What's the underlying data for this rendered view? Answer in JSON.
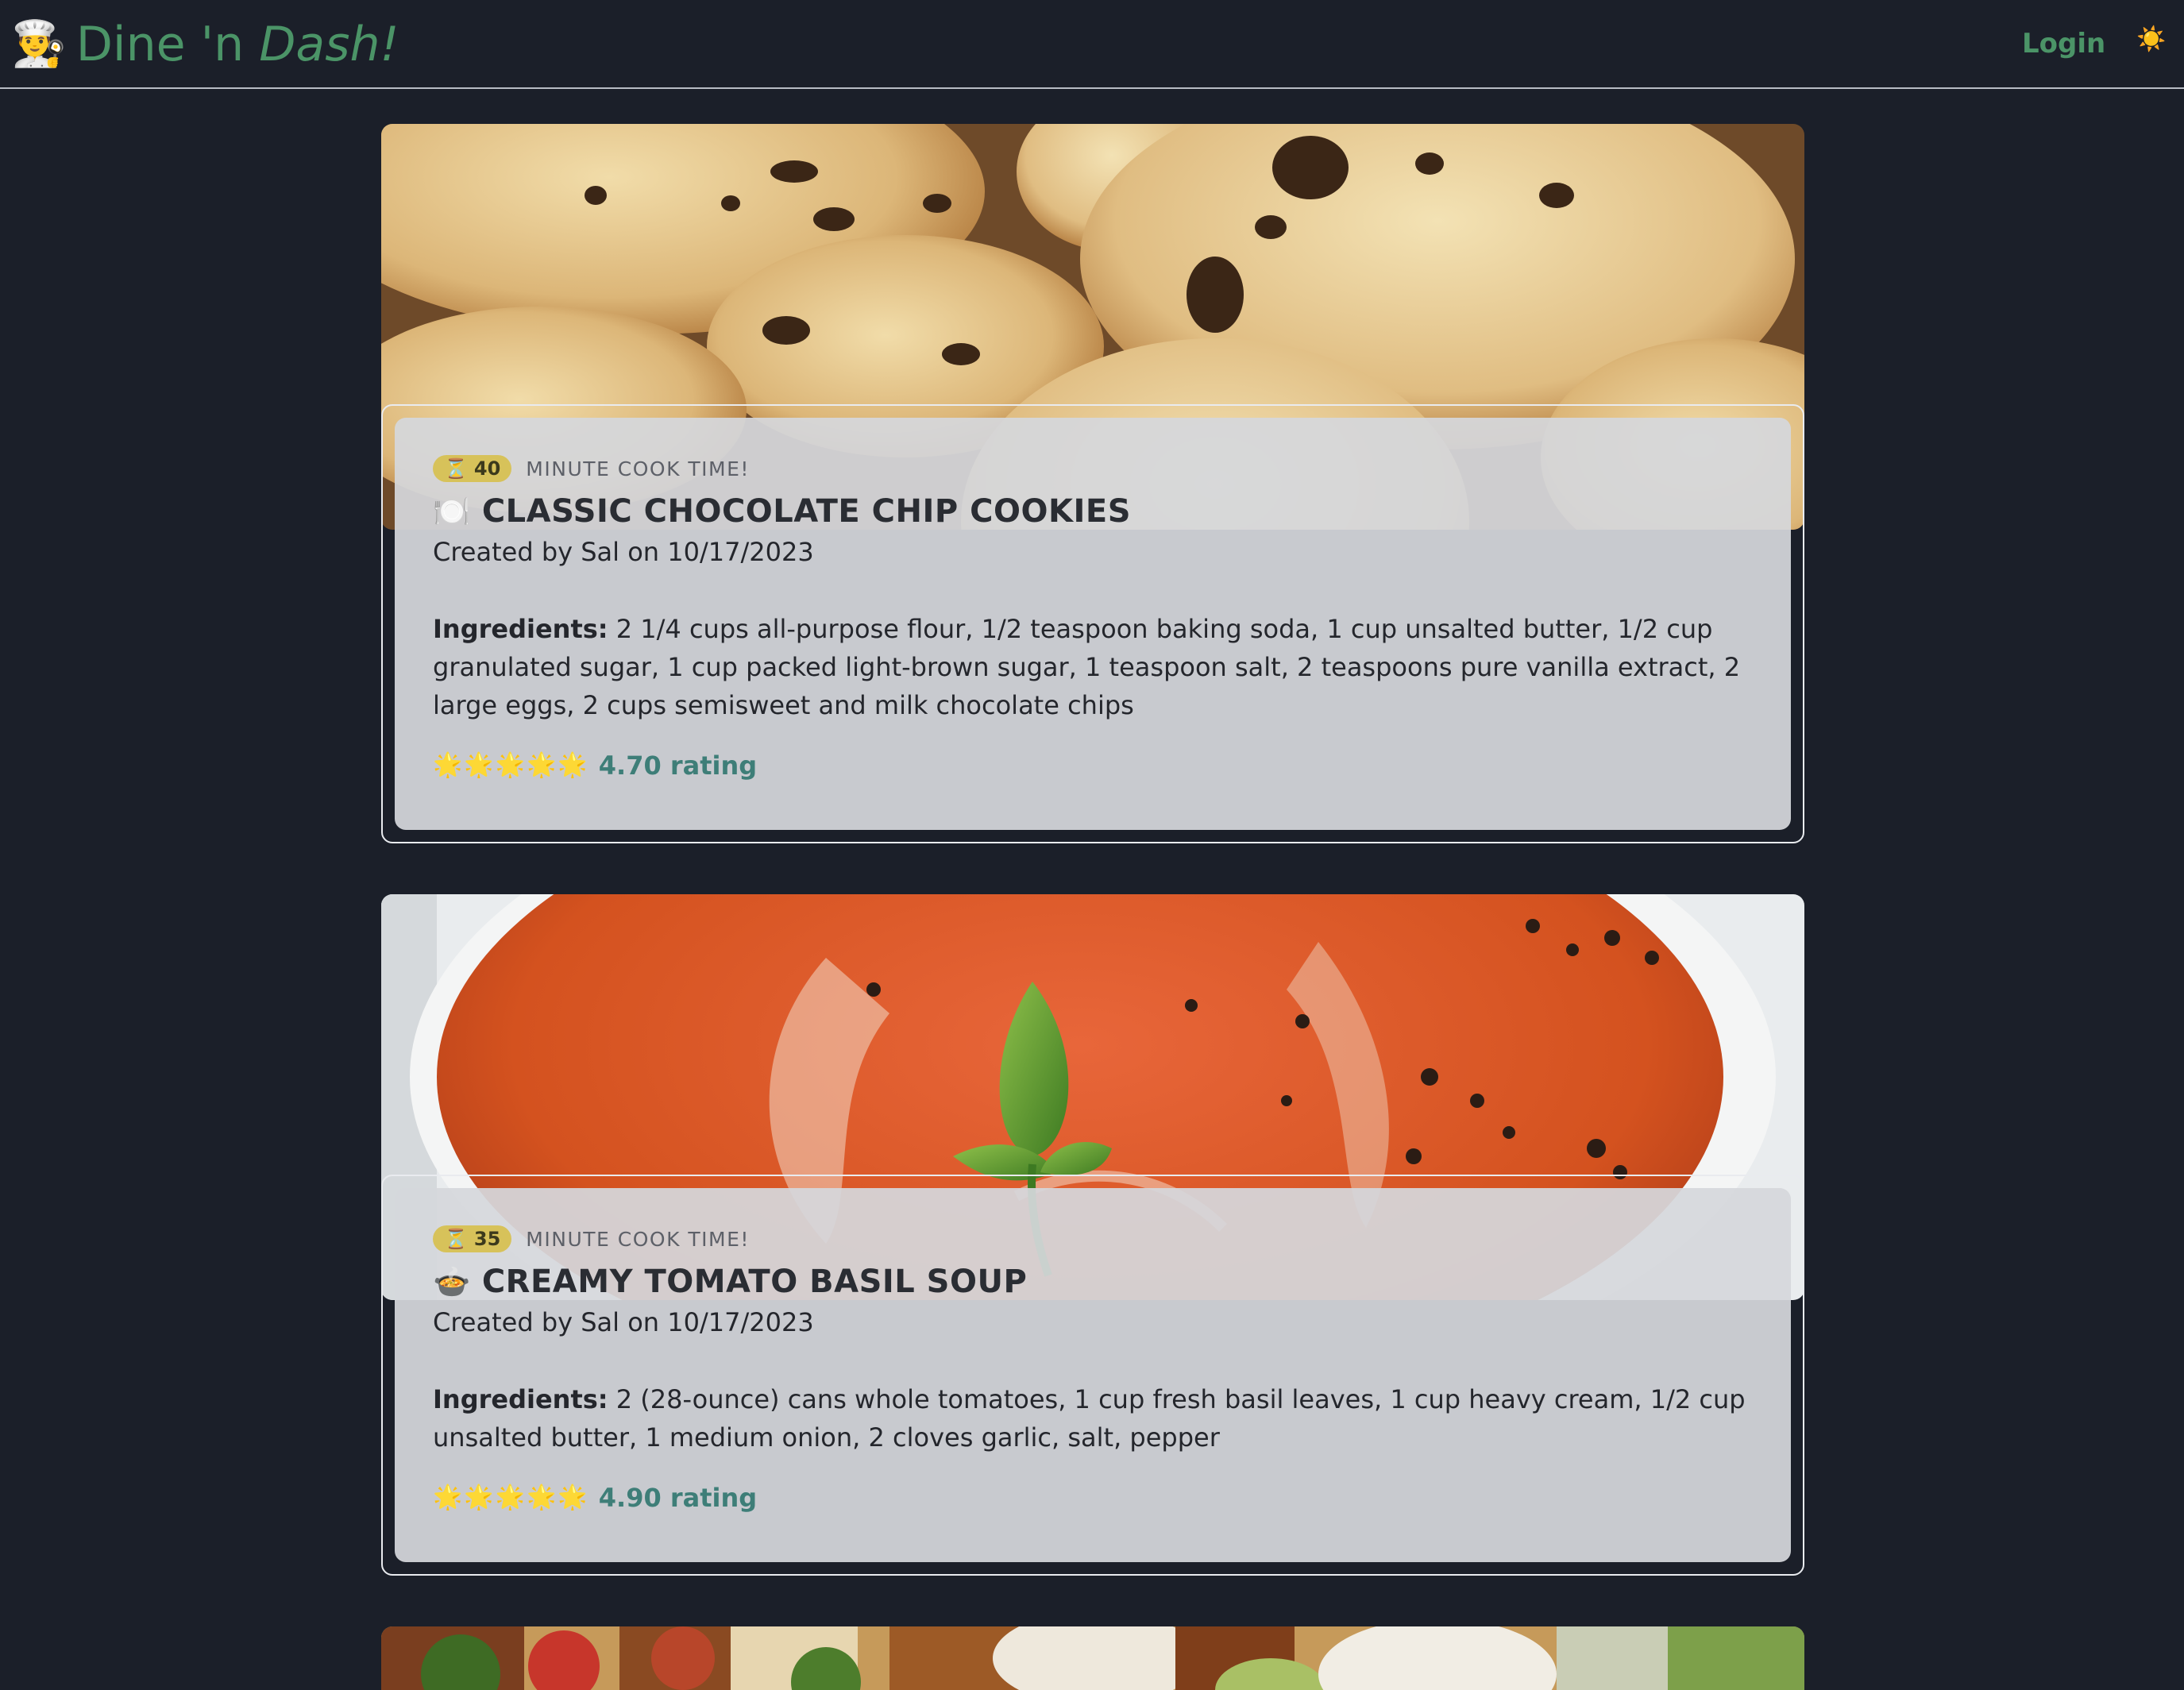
{
  "header": {
    "logo_emoji": "👨‍🍳",
    "brand_main": "Dine 'n ",
    "brand_accent": "Dash!",
    "login_label": "Login",
    "theme_icon": "☀️"
  },
  "recipes": [
    {
      "cook_time": "40",
      "time_icon": "⏳",
      "time_caption": "MINUTE COOK TIME!",
      "dish_icon": "🍽️",
      "title": "CLASSIC CHOCOLATE CHIP COOKIES",
      "created": "Created by Sal on 10/17/2023",
      "ingredients_label": "Ingredients:",
      "ingredients": "2 1/4 cups all-purpose flour, 1/2 teaspoon baking soda, 1 cup unsalted butter, 1/2 cup granulated sugar, 1 cup packed light-brown sugar, 1 teaspoon salt, 2 teaspoons pure vanilla extract, 2 large eggs, 2 cups semisweet and milk chocolate chips",
      "stars": "🌟🌟🌟🌟🌟",
      "rating": "4.70 rating",
      "image": "chocolate-chip-cookies"
    },
    {
      "cook_time": "35",
      "time_icon": "⏳",
      "time_caption": "MINUTE COOK TIME!",
      "dish_icon": "🍲",
      "title": "CREAMY TOMATO BASIL SOUP",
      "created": "Created by Sal on 10/17/2023",
      "ingredients_label": "Ingredients:",
      "ingredients": "2 (28-ounce) cans whole tomatoes, 1 cup fresh basil leaves, 1 cup heavy cream, 1/2 cup unsalted butter, 1 medium onion, 2 cloves garlic, salt, pepper",
      "stars": "🌟🌟🌟🌟🌟",
      "rating": "4.90 rating",
      "image": "tomato-basil-soup"
    },
    {
      "image": "taco-salad"
    }
  ],
  "colors": {
    "page_bg": "#1b1f29",
    "brand_green": "#4b9467",
    "badge_yellow": "#d7c25a",
    "rating_teal": "#3e7e78"
  }
}
